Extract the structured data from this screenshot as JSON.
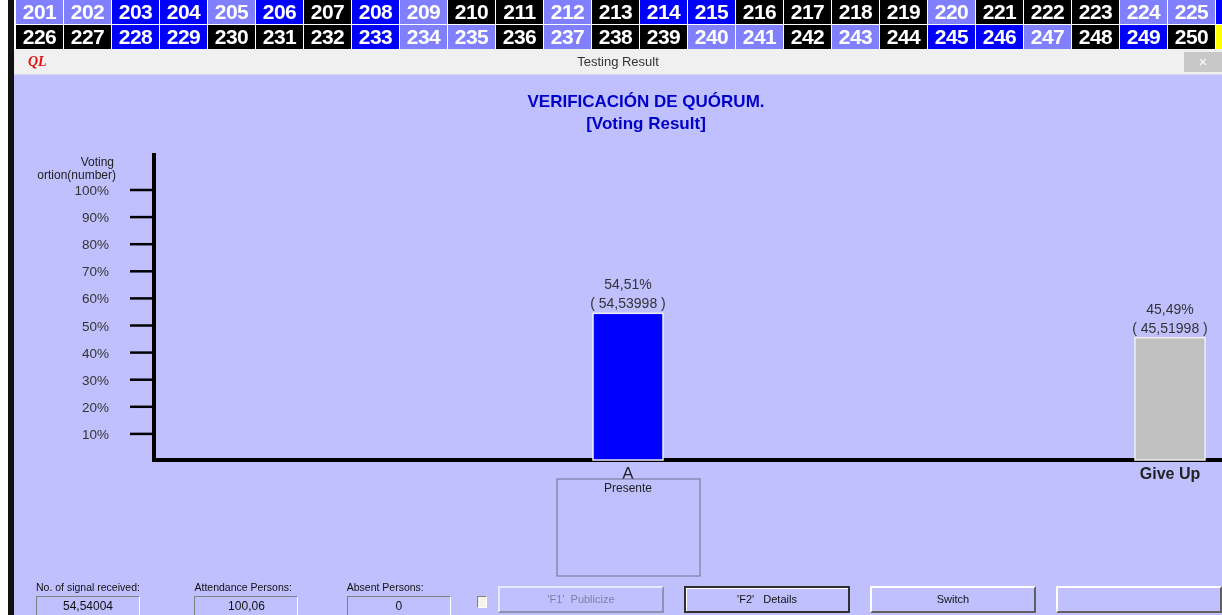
{
  "seat_board": {
    "rows": [
      [
        {
          "label": "201",
          "color": "#8080ff"
        },
        {
          "label": "202",
          "color": "#8080ff"
        },
        {
          "label": "203",
          "color": "#0000ff"
        },
        {
          "label": "204",
          "color": "#0000ff"
        },
        {
          "label": "205",
          "color": "#8080ff"
        },
        {
          "label": "206",
          "color": "#0000ff"
        },
        {
          "label": "207",
          "color": "#000000"
        },
        {
          "label": "208",
          "color": "#0000ff"
        },
        {
          "label": "209",
          "color": "#8080ff"
        },
        {
          "label": "210",
          "color": "#000000"
        },
        {
          "label": "211",
          "color": "#000000"
        },
        {
          "label": "212",
          "color": "#8080ff"
        },
        {
          "label": "213",
          "color": "#000000"
        },
        {
          "label": "214",
          "color": "#0000ff"
        },
        {
          "label": "215",
          "color": "#0000ff"
        },
        {
          "label": "216",
          "color": "#000000"
        },
        {
          "label": "217",
          "color": "#000000"
        },
        {
          "label": "218",
          "color": "#000000"
        },
        {
          "label": "219",
          "color": "#000000"
        },
        {
          "label": "220",
          "color": "#8080ff"
        },
        {
          "label": "221",
          "color": "#000000"
        },
        {
          "label": "222",
          "color": "#000000"
        },
        {
          "label": "223",
          "color": "#000000"
        },
        {
          "label": "224",
          "color": "#8080ff"
        },
        {
          "label": "225",
          "color": "#8080ff"
        },
        {
          "color": "#0000ff"
        }
      ],
      [
        {
          "label": "226",
          "color": "#000000"
        },
        {
          "label": "227",
          "color": "#000000"
        },
        {
          "label": "228",
          "color": "#0000ff"
        },
        {
          "label": "229",
          "color": "#0000ff"
        },
        {
          "label": "230",
          "color": "#000000"
        },
        {
          "label": "231",
          "color": "#000000"
        },
        {
          "label": "232",
          "color": "#000000"
        },
        {
          "label": "233",
          "color": "#0000ff"
        },
        {
          "label": "234",
          "color": "#8080ff"
        },
        {
          "label": "235",
          "color": "#8080ff"
        },
        {
          "label": "236",
          "color": "#000000"
        },
        {
          "label": "237",
          "color": "#8080ff"
        },
        {
          "label": "238",
          "color": "#000000"
        },
        {
          "label": "239",
          "color": "#000000"
        },
        {
          "label": "240",
          "color": "#8080ff"
        },
        {
          "label": "241",
          "color": "#8080ff"
        },
        {
          "label": "242",
          "color": "#000000"
        },
        {
          "label": "243",
          "color": "#8080ff"
        },
        {
          "label": "244",
          "color": "#000000"
        },
        {
          "label": "245",
          "color": "#0000ff"
        },
        {
          "label": "246",
          "color": "#0000ff"
        },
        {
          "label": "247",
          "color": "#8080ff"
        },
        {
          "label": "248",
          "color": "#000000"
        },
        {
          "label": "249",
          "color": "#0000ff"
        },
        {
          "label": "250",
          "color": "#000000"
        },
        {
          "color": "#ffff00"
        }
      ]
    ]
  },
  "window": {
    "logo": "QL",
    "title": "Testing Result",
    "close": "×"
  },
  "heading": {
    "title": "VERIFICACIÓN DE QUÓRUM.",
    "subtitle": "[Voting Result]"
  },
  "chart_data": {
    "type": "bar",
    "ylabel": "Voting ortion(number)",
    "series": [
      {
        "name": "A",
        "color": "#0000ff",
        "values": [
          54.5,
          null
        ]
      },
      {
        "name": "Give Up",
        "color": "#c0c0c0",
        "values": [
          null,
          45.5
        ]
      }
    ],
    "ylim": [
      0,
      100
    ],
    "yticks": [
      {
        "value": 100,
        "label": "100%"
      },
      {
        "value": 90,
        "label": "90%"
      },
      {
        "value": 80,
        "label": "80%"
      },
      {
        "value": 70,
        "label": "70%"
      },
      {
        "value": 60,
        "label": "60%"
      },
      {
        "value": 50,
        "label": "50%"
      },
      {
        "value": 40,
        "label": "40%"
      },
      {
        "value": 30,
        "label": "30%"
      },
      {
        "value": 20,
        "label": "20%"
      },
      {
        "value": 10,
        "label": "10%"
      }
    ],
    "value_labels": [
      "54,51%",
      "45,49%"
    ],
    "annotations": [
      "( 54,53998 )",
      "( 45,51998 )"
    ]
  },
  "legend": {
    "label": "Presente"
  },
  "stats": [
    {
      "label": "No. of signal received:",
      "value": "54,54004"
    },
    {
      "label": "Attendance Persons:",
      "value": "100,06"
    },
    {
      "label": "Absent Persons:",
      "value": "0"
    }
  ],
  "publish_checkbox": {
    "checked": false
  },
  "buttons": [
    {
      "label": "'F1'  Publicize",
      "disabled": true,
      "default": false
    },
    {
      "label": "'F2'   Details",
      "disabled": false,
      "default": true
    },
    {
      "label": "Switch",
      "disabled": false,
      "default": false
    },
    {
      "disabled": false,
      "default": false
    }
  ]
}
